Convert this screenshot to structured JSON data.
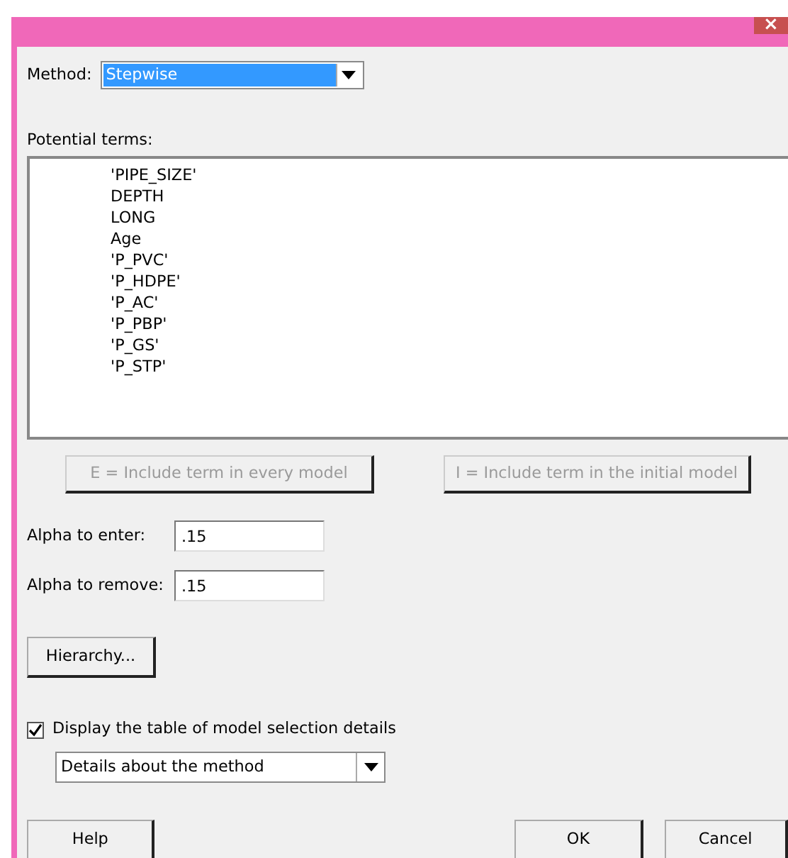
{
  "window": {
    "close": "×"
  },
  "method": {
    "label": "Method:",
    "value": "Stepwise",
    "focused": true
  },
  "potential_terms": {
    "label": "Potential terms:",
    "items": [
      "'PIPE_SIZE'",
      "DEPTH",
      "LONG",
      "Age",
      "'P_PVC'",
      "'P_HDPE'",
      "'P_AC'",
      "'P_PBP'",
      "'P_GS'",
      "'P_STP'"
    ]
  },
  "term_buttons": [
    {
      "label": "E = Include term in every model",
      "disabled": true
    },
    {
      "label": "I = Include term in the initial model",
      "disabled": true
    }
  ],
  "alphas": [
    {
      "label": "Alpha to enter:",
      "value": ".15"
    },
    {
      "label": "Alpha to remove:",
      "value": ".15"
    }
  ],
  "hierarchy_button": {
    "label": "Hierarchy..."
  },
  "display_table": {
    "label": "Display the table of model selection details",
    "checked": true
  },
  "details": {
    "value": "Details about the method"
  },
  "buttons": [
    {
      "label": "Help"
    },
    {
      "label": "OK"
    },
    {
      "label": "Cancel"
    }
  ]
}
